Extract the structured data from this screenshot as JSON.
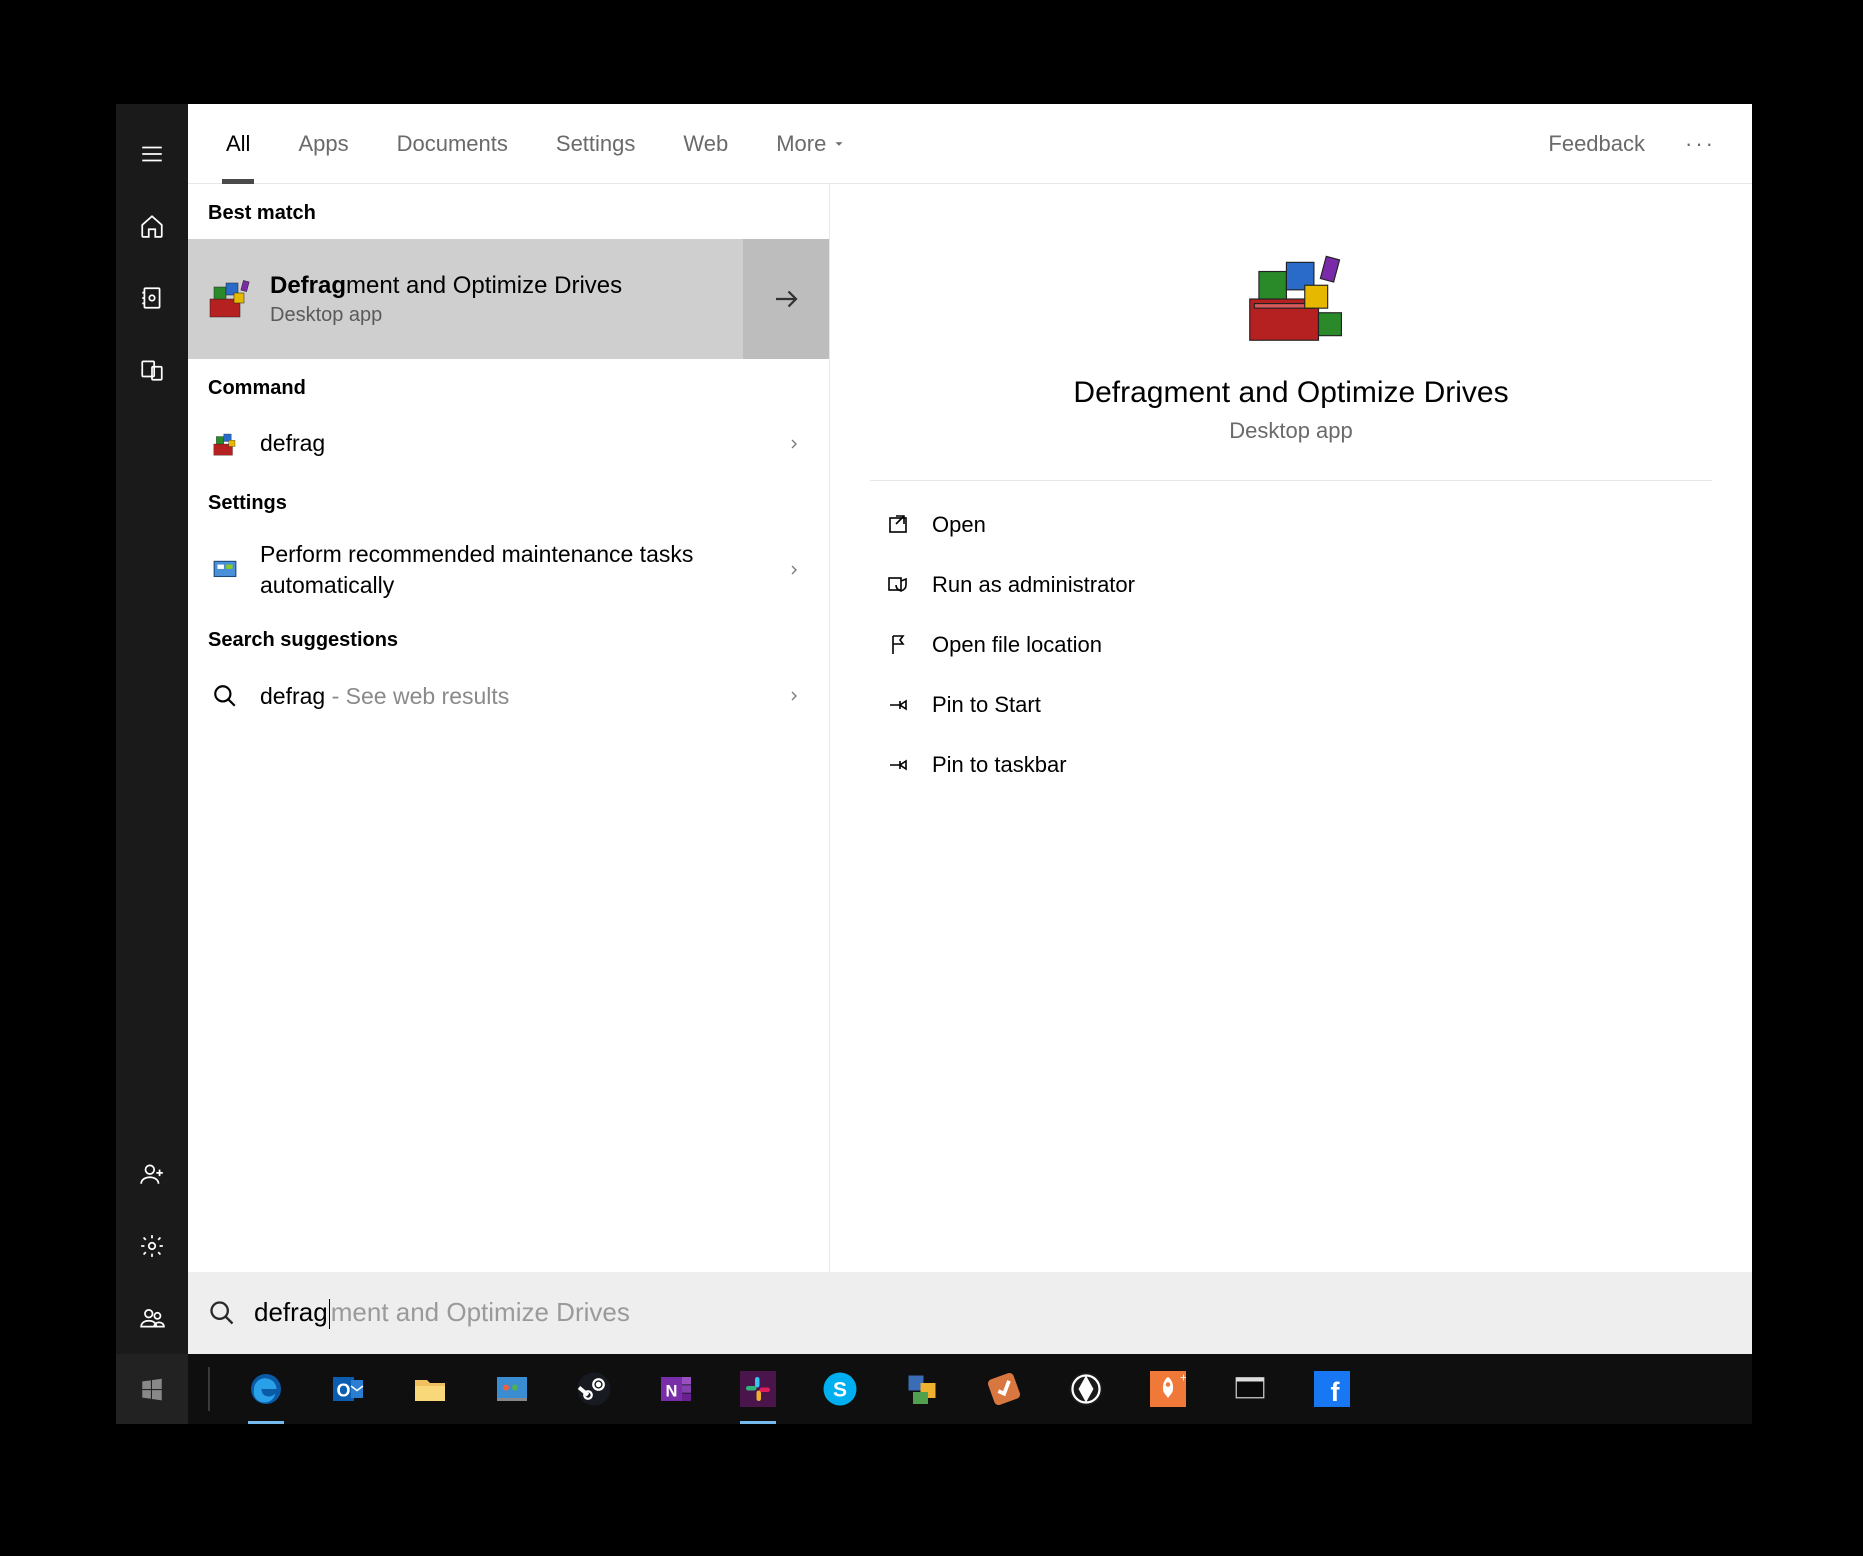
{
  "leftRail": {
    "items": [
      "menu",
      "home",
      "notebook",
      "devices"
    ],
    "bottom": [
      "add-user",
      "settings",
      "people"
    ]
  },
  "tabs": {
    "items": [
      "All",
      "Apps",
      "Documents",
      "Settings",
      "Web",
      "More"
    ],
    "activeIndex": 0,
    "feedback": "Feedback"
  },
  "sections": {
    "bestMatch": "Best match",
    "command": "Command",
    "settings": "Settings",
    "suggestions": "Search suggestions"
  },
  "bestMatch": {
    "titleBold": "Defrag",
    "titleRest": "ment and Optimize Drives",
    "subtitle": "Desktop app"
  },
  "results": {
    "command": {
      "label": "defrag"
    },
    "setting": {
      "label": "Perform recommended maintenance tasks automatically"
    },
    "web": {
      "label": "defrag",
      "hint": " - See web results"
    }
  },
  "preview": {
    "title": "Defragment and Optimize Drives",
    "subtitle": "Desktop app",
    "actions": [
      "Open",
      "Run as administrator",
      "Open file location",
      "Pin to Start",
      "Pin to taskbar"
    ]
  },
  "searchBox": {
    "typed": "defrag",
    "suggestion": "ment and Optimize Drives"
  },
  "taskbar": {
    "apps": [
      "edge",
      "outlook",
      "explorer",
      "software-center",
      "steam",
      "onenote",
      "slack",
      "skype",
      "sticky-notes",
      "todo",
      "picasa",
      "rocket",
      "terminal",
      "facebook"
    ]
  }
}
